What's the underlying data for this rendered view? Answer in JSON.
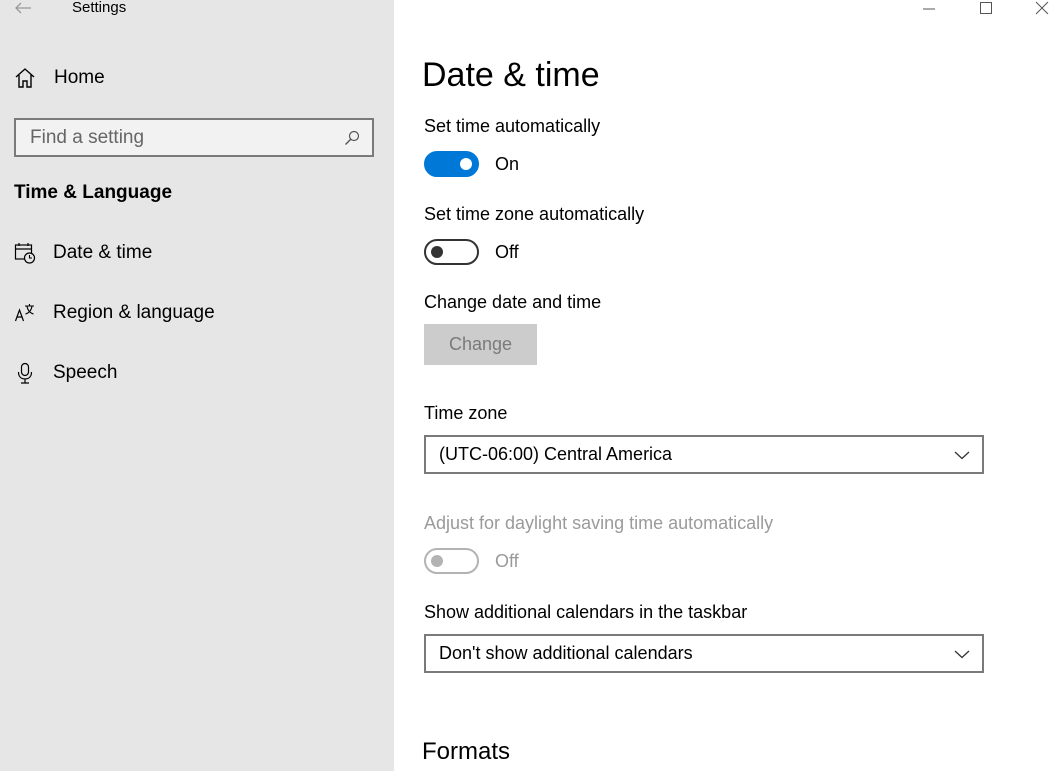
{
  "window": {
    "title": "Settings",
    "controls": [
      "minimize",
      "maximize",
      "close"
    ]
  },
  "sidebar": {
    "home_label": "Home",
    "search": {
      "placeholder": "Find a setting"
    },
    "section_heading": "Time & Language",
    "items": [
      {
        "label": "Date & time",
        "icon": "calendar-clock-icon"
      },
      {
        "label": "Region & language",
        "icon": "region-language-icon"
      },
      {
        "label": "Speech",
        "icon": "microphone-icon"
      }
    ]
  },
  "main": {
    "page_title": "Date & time",
    "set_time_auto": {
      "label": "Set time automatically",
      "state": "On"
    },
    "set_timezone_auto": {
      "label": "Set time zone automatically",
      "state": "Off"
    },
    "change_date_time": {
      "label": "Change date and time",
      "button": "Change"
    },
    "time_zone": {
      "label": "Time zone",
      "value": "(UTC-06:00) Central America"
    },
    "daylight_saving": {
      "label": "Adjust for daylight saving time automatically",
      "state": "Off"
    },
    "additional_calendars": {
      "label": "Show additional calendars in the taskbar",
      "value": "Don't show additional calendars"
    },
    "formats_heading": "Formats"
  },
  "colors": {
    "accent": "#0078d7",
    "sidebar_bg": "#e6e6e6",
    "disabled_text": "#9a9a9a",
    "button_disabled_bg": "#cccccc"
  }
}
